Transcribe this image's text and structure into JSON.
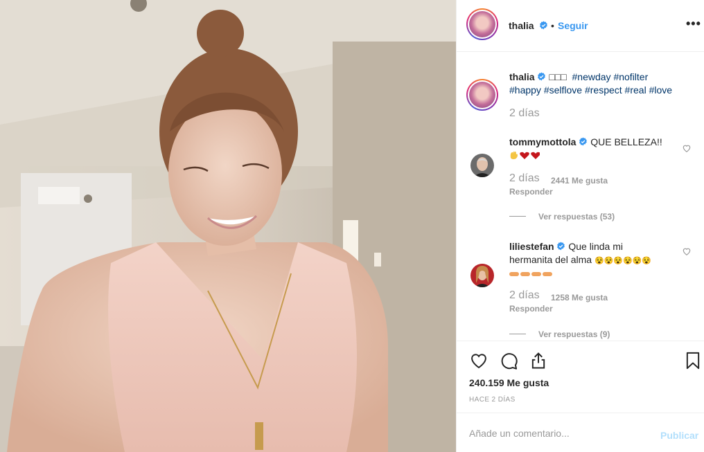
{
  "header": {
    "username": "thalia",
    "separator": "•",
    "follow_label": "Seguir",
    "more_label": "•••"
  },
  "caption": {
    "username": "thalia",
    "emoji": "□□□",
    "line1_tags": "#newday #nofilter",
    "line2_tags": "#happy #selflove #respect #real #love",
    "time": "2 días"
  },
  "comments": [
    {
      "username": "tommymottola",
      "text_line1": "QUE BELLEZA!!",
      "time": "2 días",
      "likes": "2441 Me gusta",
      "reply_label": "Responder",
      "view_replies": "Ver respuestas (53)"
    },
    {
      "username": "liliestefan",
      "text_line1": "Que linda mi",
      "text_line2": "hermanita del alma",
      "emoji_line": "😵😵😵😵😵😵",
      "time": "2 días",
      "likes": "1258 Me gusta",
      "reply_label": "Responder",
      "view_replies": "Ver respuestas (9)"
    }
  ],
  "actions": {
    "likes_count": "240.159 Me gusta",
    "posted_ago": "HACE 2 DÍAS"
  },
  "add_comment": {
    "placeholder": "Añade un comentario...",
    "publish_label": "Publicar"
  },
  "colors": {
    "link_blue": "#3897f0",
    "hashtag": "#003569",
    "muted": "#999999",
    "heart_red": "#c4161c"
  }
}
